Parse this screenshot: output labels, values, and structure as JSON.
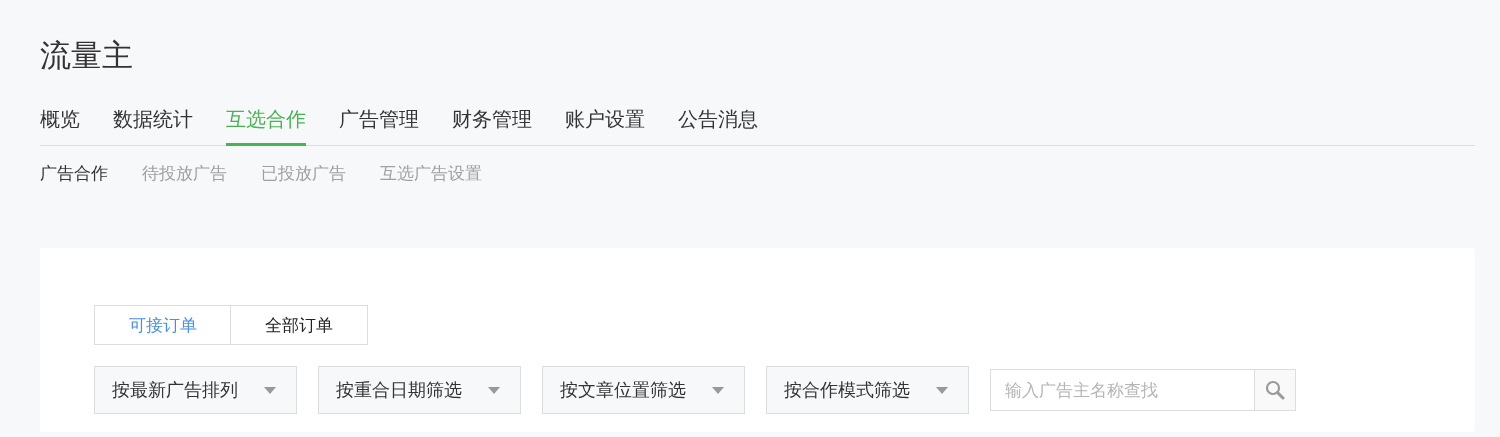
{
  "title": "流量主",
  "nav_tabs": [
    {
      "label": "概览",
      "selected": false
    },
    {
      "label": "数据统计",
      "selected": false
    },
    {
      "label": "互选合作",
      "selected": true
    },
    {
      "label": "广告管理",
      "selected": false
    },
    {
      "label": "财务管理",
      "selected": false
    },
    {
      "label": "账户设置",
      "selected": false
    },
    {
      "label": "公告消息",
      "selected": false
    }
  ],
  "sub_tabs": [
    {
      "label": "广告合作",
      "selected": true
    },
    {
      "label": "待投放广告",
      "selected": false
    },
    {
      "label": "已投放广告",
      "selected": false
    },
    {
      "label": "互选广告设置",
      "selected": false
    }
  ],
  "order_tabs": [
    {
      "label": "可接订单",
      "selected": true
    },
    {
      "label": "全部订单",
      "selected": false
    }
  ],
  "filters": [
    {
      "label": "按最新广告排列"
    },
    {
      "label": "按重合日期筛选"
    },
    {
      "label": "按文章位置筛选"
    },
    {
      "label": "按合作模式筛选"
    }
  ],
  "search": {
    "placeholder": "输入广告主名称查找"
  }
}
